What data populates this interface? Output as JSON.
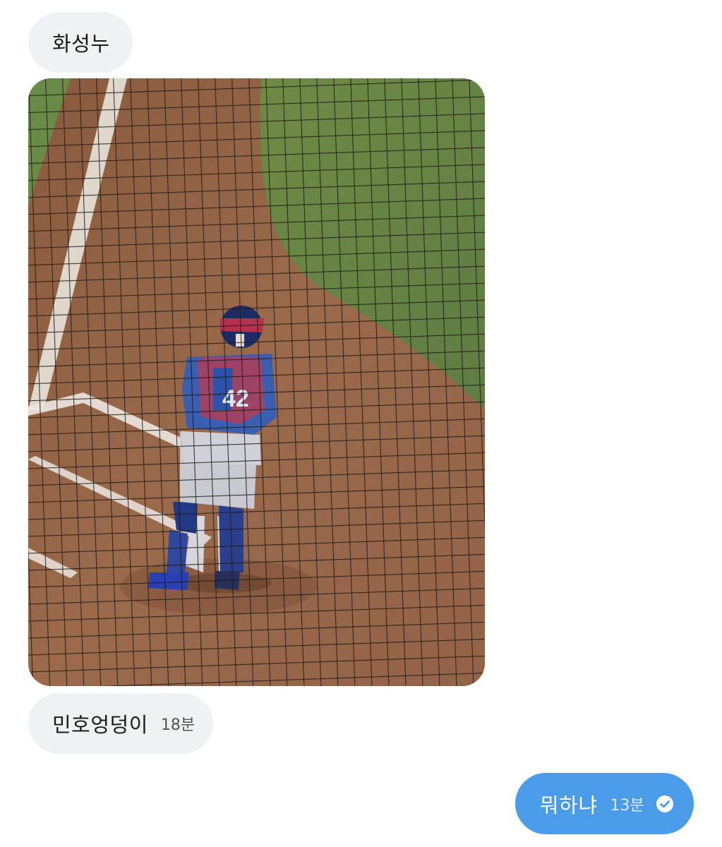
{
  "messages": [
    {
      "direction": "incoming",
      "type": "text",
      "text": "화성누"
    },
    {
      "direction": "incoming",
      "type": "photo",
      "image_icon": "photo-of-baseball-catcher"
    },
    {
      "direction": "incoming",
      "type": "text",
      "text": "민호엉덩이",
      "time": "18분"
    },
    {
      "direction": "outgoing",
      "type": "text",
      "text": "뭐하냐",
      "time": "13분",
      "status_icon": "check-circle-icon"
    }
  ],
  "colors": {
    "incoming_bubble": "#eff2f4",
    "outgoing_bubble": "#4a9be8",
    "background": "#ffffff"
  }
}
